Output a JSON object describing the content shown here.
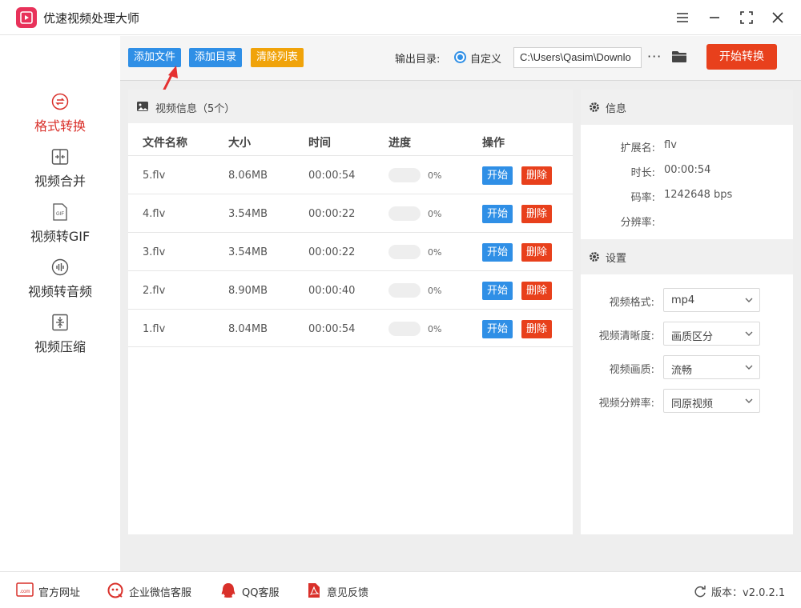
{
  "app": {
    "title": "优速视频处理大师"
  },
  "window": {
    "menu_icon": "hamburger-icon",
    "minimize_icon": "minimize-icon",
    "maximize_icon": "maximize-icon",
    "close_icon": "close-icon"
  },
  "sidebar": {
    "items": [
      {
        "label": "格式转换",
        "icon": "format-convert-icon",
        "active": true
      },
      {
        "label": "视频合并",
        "icon": "merge-icon",
        "active": false
      },
      {
        "label": "视频转GIF",
        "icon": "gif-icon",
        "active": false
      },
      {
        "label": "视频转音频",
        "icon": "audio-icon",
        "active": false
      },
      {
        "label": "视频压缩",
        "icon": "compress-icon",
        "active": false
      }
    ]
  },
  "toolbar": {
    "add_file": "添加文件",
    "add_dir": "添加目录",
    "clear_list": "清除列表",
    "output_label": "输出目录:",
    "custom_label": "自定义",
    "output_path": "C:\\Users\\Qasim\\Downlo",
    "more": "···",
    "start_all": "开始转换"
  },
  "video_panel": {
    "title": "视频信息（5个）",
    "headers": {
      "name": "文件名称",
      "size": "大小",
      "time": "时间",
      "progress": "进度",
      "action": "操作"
    },
    "rows": [
      {
        "name": "5.flv",
        "size": "8.06MB",
        "time": "00:00:54",
        "progress": "0%",
        "progress_value": 0
      },
      {
        "name": "4.flv",
        "size": "3.54MB",
        "time": "00:00:22",
        "progress": "0%",
        "progress_value": 0
      },
      {
        "name": "3.flv",
        "size": "3.54MB",
        "time": "00:00:22",
        "progress": "0%",
        "progress_value": 0
      },
      {
        "name": "2.flv",
        "size": "8.90MB",
        "time": "00:00:40",
        "progress": "0%",
        "progress_value": 0
      },
      {
        "name": "1.flv",
        "size": "8.04MB",
        "time": "00:00:54",
        "progress": "0%",
        "progress_value": 0
      }
    ],
    "start_label": "开始",
    "delete_label": "删除"
  },
  "info": {
    "title": "信息",
    "fields": [
      {
        "key": "扩展名:",
        "value": "flv"
      },
      {
        "key": "时长:",
        "value": "00:00:54"
      },
      {
        "key": "码率:",
        "value": "1242648 bps"
      },
      {
        "key": "分辨率:",
        "value": ""
      }
    ]
  },
  "settings": {
    "title": "设置",
    "fields": [
      {
        "key": "视频格式:",
        "value": "mp4"
      },
      {
        "key": "视频清晰度:",
        "value": "画质区分"
      },
      {
        "key": "视频画质:",
        "value": "流畅"
      },
      {
        "key": "视频分辨率:",
        "value": "同原视频"
      }
    ]
  },
  "footer": {
    "links": [
      {
        "label": "官方网址",
        "icon": "website-icon"
      },
      {
        "label": "企业微信客服",
        "icon": "wechat-service-icon"
      },
      {
        "label": "QQ客服",
        "icon": "qq-icon"
      },
      {
        "label": "意见反馈",
        "icon": "feedback-icon"
      }
    ],
    "version": "版本：v2.0.2.1"
  },
  "colors": {
    "accent": "#2f8fe6",
    "danger": "#e8401c",
    "warning": "#f0a30a",
    "active": "#d9302a"
  }
}
